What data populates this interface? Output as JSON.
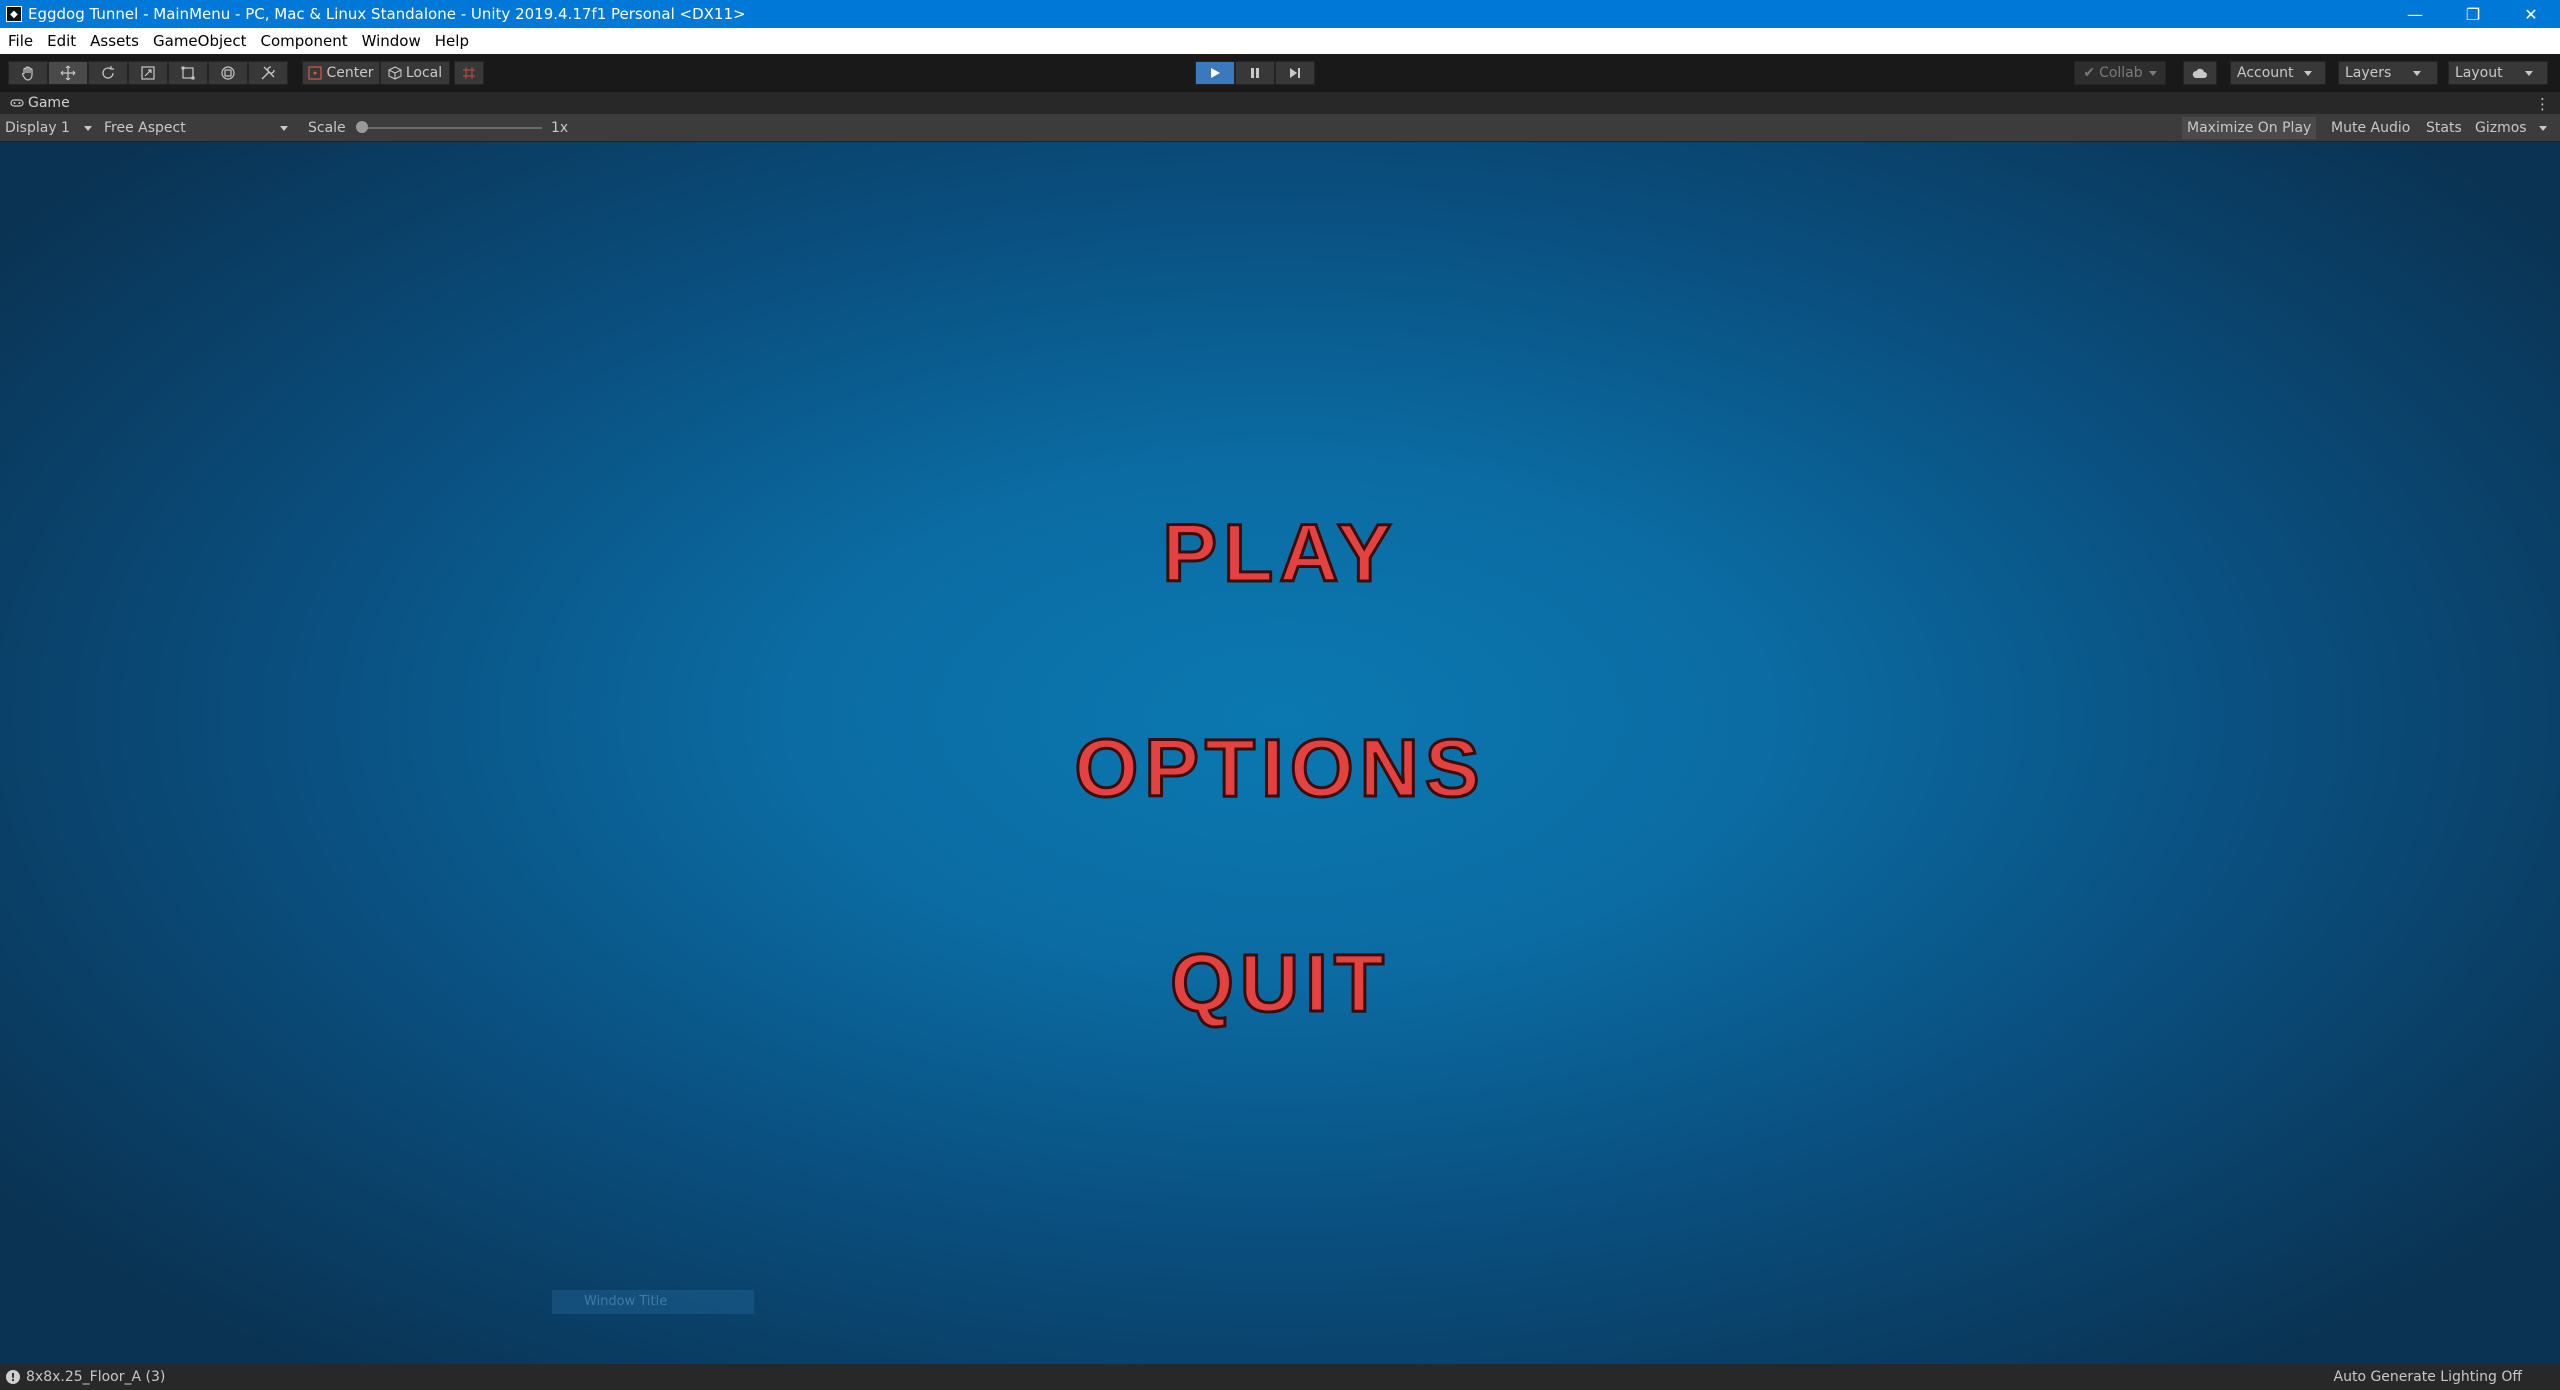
{
  "window": {
    "title": "Eggdog Tunnel - MainMenu - PC, Mac & Linux Standalone - Unity 2019.4.17f1 Personal <DX11>",
    "minimize": "—",
    "maximize": "❐",
    "close": "✕"
  },
  "menubar": {
    "items": [
      "File",
      "Edit",
      "Assets",
      "GameObject",
      "Component",
      "Window",
      "Help"
    ]
  },
  "toolbar": {
    "pivot_label": "Center",
    "space_label": "Local",
    "collab_label": "Collab",
    "account_label": "Account",
    "layers_label": "Layers",
    "layout_label": "Layout",
    "accent": "#3a79bb"
  },
  "game_tab": {
    "label": "Game"
  },
  "game_controls": {
    "display": "Display 1",
    "aspect": "Free Aspect",
    "scale_label": "Scale",
    "scale_value": "1x",
    "maximize_on_play": "Maximize On Play",
    "mute_audio": "Mute Audio",
    "stats": "Stats",
    "gizmos": "Gizmos"
  },
  "game_view": {
    "play": "PLAY",
    "options": "OPTIONS",
    "quit": "QUIT",
    "text_color": "#e44241",
    "ghost_tooltip": "Window Title"
  },
  "statusbar": {
    "message": "8x8x.25_Floor_A (3)",
    "lighting": "Auto Generate Lighting Off"
  }
}
